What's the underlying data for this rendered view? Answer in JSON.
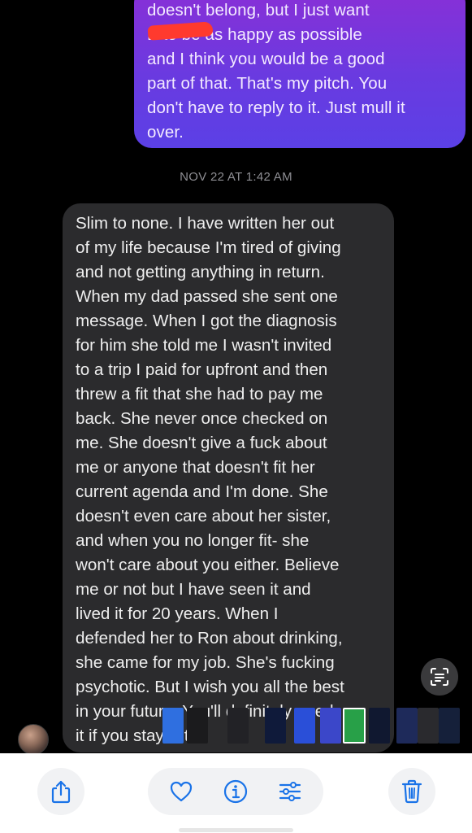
{
  "conversation": {
    "sent_message": "doesn't belong, but I just want\nB to be as happy as possible\nand I think you would be a good\npart of that. That's my pitch. You\ndon't have to reply to it. Just mull it\nover.",
    "timestamp": "NOV 22 AT 1:42 AM",
    "received_message": "Slim to none. I have written her out\nof my life because I'm tired of giving\nand not getting anything in return.\nWhen my dad passed she sent one\nmessage. When I got the diagnosis\nfor him she told me I wasn't invited\nto a trip I paid for upfront and then\nthrew a fit that she had to pay me\nback. She never once checked on\nme. She doesn't give a fuck about\nme or anyone that doesn't fit her\ncurrent agenda and I'm done. She\ndoesn't even care about her sister,\nand when you no longer fit- she\nwon't care about you either. Believe\nme or not but I have seen it and\nlived it for 20 years. When I\ndefended her to Ron about drinking,\nshe came for my job. She's fucking\npsychotic. But I wish you all the best\nin your future. You'll definitely need\nit if you stay with"
  },
  "overlay": {
    "live_text_icon": "live-text-icon",
    "avatar_icon": "contact-avatar"
  },
  "thumbnails": [
    {
      "color": "#2f6fe0"
    },
    {
      "color": "#1b1b1d"
    },
    {
      "color": "#222226"
    },
    {
      "color": "#0f1a3a"
    },
    {
      "color": "#2a4fd8"
    },
    {
      "color": "#3b47c9"
    },
    {
      "color": "#28a048"
    },
    {
      "color": "#101830"
    },
    {
      "color": "#1e2a5a"
    },
    {
      "color": "#2a2a2e"
    },
    {
      "color": "#15203a"
    }
  ],
  "toolbar": {
    "share_icon": "share-icon",
    "favorite_icon": "heart-icon",
    "info_icon": "info-icon",
    "adjust_icon": "sliders-icon",
    "delete_icon": "trash-icon",
    "accent": "#1a73e8"
  }
}
